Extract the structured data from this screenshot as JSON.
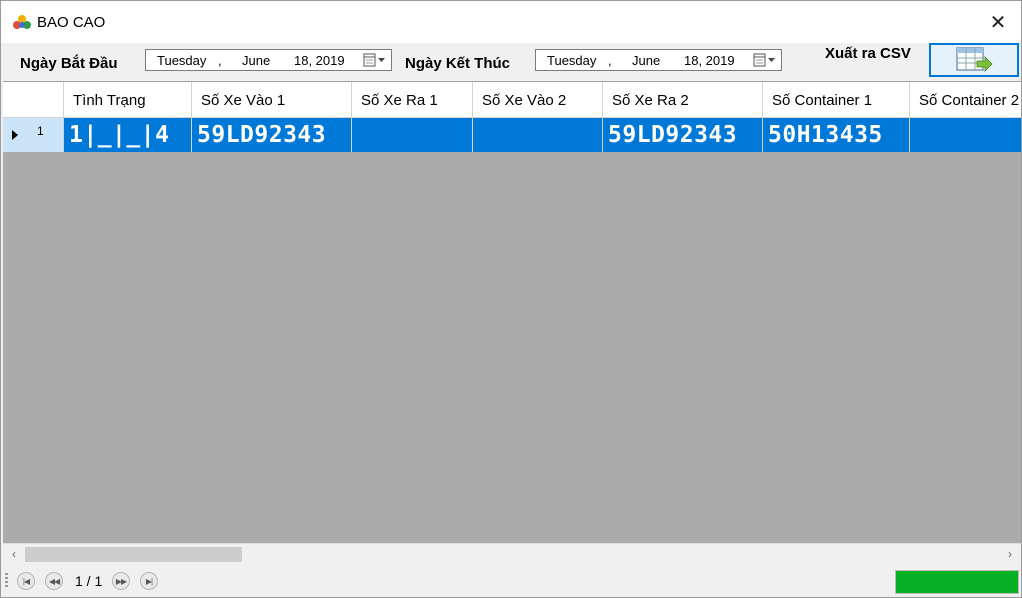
{
  "window": {
    "title": "BAO CAO"
  },
  "toolbar": {
    "start_label": "Ngày Bắt Đầu",
    "end_label": "Ngày Kết Thúc",
    "start_date": {
      "weekday": "Tuesday",
      "sep": ",",
      "month": "June",
      "day_year": "18, 2019"
    },
    "end_date": {
      "weekday": "Tuesday",
      "sep": ",",
      "month": "June",
      "day_year": "18, 2019"
    },
    "export_label": "Xuất ra CSV"
  },
  "grid": {
    "columns": [
      "Tình Trạng",
      "Số Xe Vào 1",
      "Số Xe Ra 1",
      "Số Xe Vào 2",
      "Số Xe Ra 2",
      "Số Container 1",
      "Số Container 2"
    ],
    "rows": [
      {
        "index": "1",
        "cells": [
          "1|_|_|4",
          "59LD92343",
          "",
          "",
          "59LD92343",
          "50H13435",
          ""
        ]
      }
    ]
  },
  "statusbar": {
    "page_info": "1 / 1",
    "progress": 1.0
  },
  "colors": {
    "selection": "#0078d7",
    "progress": "#06b025",
    "grid_bg": "#ababab"
  }
}
